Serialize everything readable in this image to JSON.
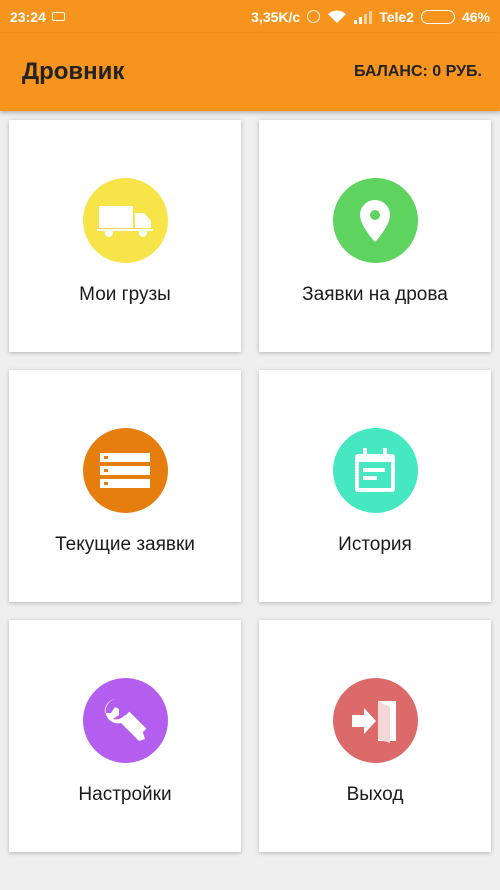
{
  "status_bar": {
    "time": "23:24",
    "speed": "3,35K/c",
    "carrier": "Tele2",
    "battery": "46%",
    "battery_level": 0.46
  },
  "app_bar": {
    "title": "Дровник",
    "balance": "БАЛАНС: 0 РУБ."
  },
  "menu": [
    {
      "label": "Мои грузы",
      "icon": "truck-icon",
      "color": "#f6e449"
    },
    {
      "label": "Заявки на дрова",
      "icon": "location-pin-icon",
      "color": "#5fd35f"
    },
    {
      "label": "Текущие заявки",
      "icon": "list-icon",
      "color": "#e67e0e"
    },
    {
      "label": "История",
      "icon": "calendar-icon",
      "color": "#46e8c2"
    },
    {
      "label": "Настройки",
      "icon": "wrench-icon",
      "color": "#b45ef0"
    },
    {
      "label": "Выход",
      "icon": "exit-icon",
      "color": "#dc6a6a"
    }
  ]
}
